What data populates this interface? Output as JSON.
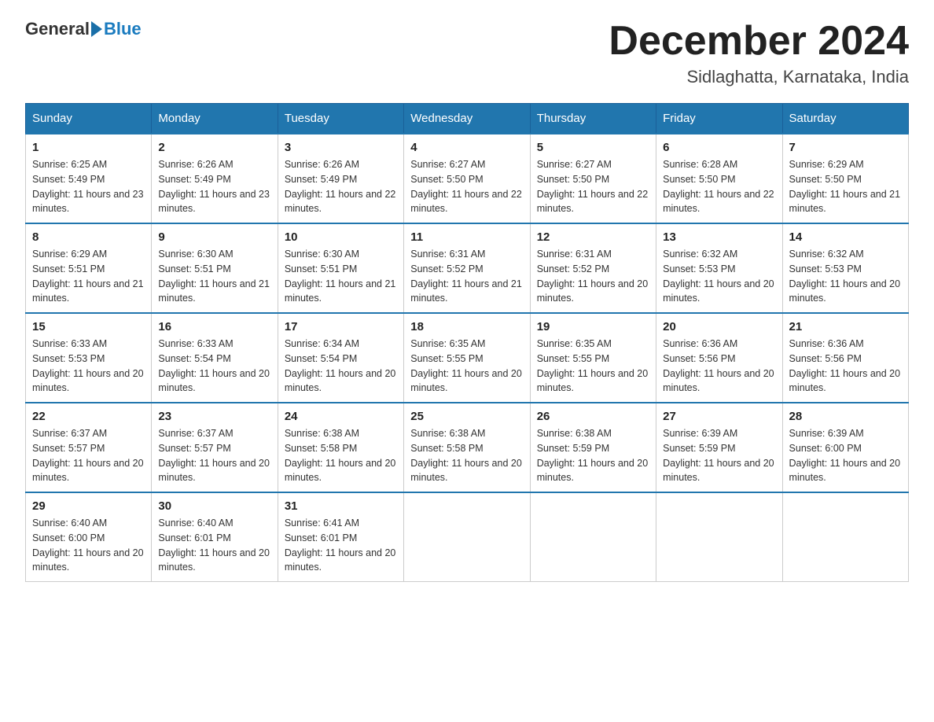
{
  "header": {
    "logo_general": "General",
    "logo_blue": "Blue",
    "month_title": "December 2024",
    "location": "Sidlaghatta, Karnataka, India"
  },
  "weekdays": [
    "Sunday",
    "Monday",
    "Tuesday",
    "Wednesday",
    "Thursday",
    "Friday",
    "Saturday"
  ],
  "weeks": [
    [
      {
        "day": "1",
        "sunrise": "6:25 AM",
        "sunset": "5:49 PM",
        "daylight": "11 hours and 23 minutes."
      },
      {
        "day": "2",
        "sunrise": "6:26 AM",
        "sunset": "5:49 PM",
        "daylight": "11 hours and 23 minutes."
      },
      {
        "day": "3",
        "sunrise": "6:26 AM",
        "sunset": "5:49 PM",
        "daylight": "11 hours and 22 minutes."
      },
      {
        "day": "4",
        "sunrise": "6:27 AM",
        "sunset": "5:50 PM",
        "daylight": "11 hours and 22 minutes."
      },
      {
        "day": "5",
        "sunrise": "6:27 AM",
        "sunset": "5:50 PM",
        "daylight": "11 hours and 22 minutes."
      },
      {
        "day": "6",
        "sunrise": "6:28 AM",
        "sunset": "5:50 PM",
        "daylight": "11 hours and 22 minutes."
      },
      {
        "day": "7",
        "sunrise": "6:29 AM",
        "sunset": "5:50 PM",
        "daylight": "11 hours and 21 minutes."
      }
    ],
    [
      {
        "day": "8",
        "sunrise": "6:29 AM",
        "sunset": "5:51 PM",
        "daylight": "11 hours and 21 minutes."
      },
      {
        "day": "9",
        "sunrise": "6:30 AM",
        "sunset": "5:51 PM",
        "daylight": "11 hours and 21 minutes."
      },
      {
        "day": "10",
        "sunrise": "6:30 AM",
        "sunset": "5:51 PM",
        "daylight": "11 hours and 21 minutes."
      },
      {
        "day": "11",
        "sunrise": "6:31 AM",
        "sunset": "5:52 PM",
        "daylight": "11 hours and 21 minutes."
      },
      {
        "day": "12",
        "sunrise": "6:31 AM",
        "sunset": "5:52 PM",
        "daylight": "11 hours and 20 minutes."
      },
      {
        "day": "13",
        "sunrise": "6:32 AM",
        "sunset": "5:53 PM",
        "daylight": "11 hours and 20 minutes."
      },
      {
        "day": "14",
        "sunrise": "6:32 AM",
        "sunset": "5:53 PM",
        "daylight": "11 hours and 20 minutes."
      }
    ],
    [
      {
        "day": "15",
        "sunrise": "6:33 AM",
        "sunset": "5:53 PM",
        "daylight": "11 hours and 20 minutes."
      },
      {
        "day": "16",
        "sunrise": "6:33 AM",
        "sunset": "5:54 PM",
        "daylight": "11 hours and 20 minutes."
      },
      {
        "day": "17",
        "sunrise": "6:34 AM",
        "sunset": "5:54 PM",
        "daylight": "11 hours and 20 minutes."
      },
      {
        "day": "18",
        "sunrise": "6:35 AM",
        "sunset": "5:55 PM",
        "daylight": "11 hours and 20 minutes."
      },
      {
        "day": "19",
        "sunrise": "6:35 AM",
        "sunset": "5:55 PM",
        "daylight": "11 hours and 20 minutes."
      },
      {
        "day": "20",
        "sunrise": "6:36 AM",
        "sunset": "5:56 PM",
        "daylight": "11 hours and 20 minutes."
      },
      {
        "day": "21",
        "sunrise": "6:36 AM",
        "sunset": "5:56 PM",
        "daylight": "11 hours and 20 minutes."
      }
    ],
    [
      {
        "day": "22",
        "sunrise": "6:37 AM",
        "sunset": "5:57 PM",
        "daylight": "11 hours and 20 minutes."
      },
      {
        "day": "23",
        "sunrise": "6:37 AM",
        "sunset": "5:57 PM",
        "daylight": "11 hours and 20 minutes."
      },
      {
        "day": "24",
        "sunrise": "6:38 AM",
        "sunset": "5:58 PM",
        "daylight": "11 hours and 20 minutes."
      },
      {
        "day": "25",
        "sunrise": "6:38 AM",
        "sunset": "5:58 PM",
        "daylight": "11 hours and 20 minutes."
      },
      {
        "day": "26",
        "sunrise": "6:38 AM",
        "sunset": "5:59 PM",
        "daylight": "11 hours and 20 minutes."
      },
      {
        "day": "27",
        "sunrise": "6:39 AM",
        "sunset": "5:59 PM",
        "daylight": "11 hours and 20 minutes."
      },
      {
        "day": "28",
        "sunrise": "6:39 AM",
        "sunset": "6:00 PM",
        "daylight": "11 hours and 20 minutes."
      }
    ],
    [
      {
        "day": "29",
        "sunrise": "6:40 AM",
        "sunset": "6:00 PM",
        "daylight": "11 hours and 20 minutes."
      },
      {
        "day": "30",
        "sunrise": "6:40 AM",
        "sunset": "6:01 PM",
        "daylight": "11 hours and 20 minutes."
      },
      {
        "day": "31",
        "sunrise": "6:41 AM",
        "sunset": "6:01 PM",
        "daylight": "11 hours and 20 minutes."
      },
      null,
      null,
      null,
      null
    ]
  ],
  "labels": {
    "sunrise_prefix": "Sunrise: ",
    "sunset_prefix": "Sunset: ",
    "daylight_prefix": "Daylight: "
  }
}
